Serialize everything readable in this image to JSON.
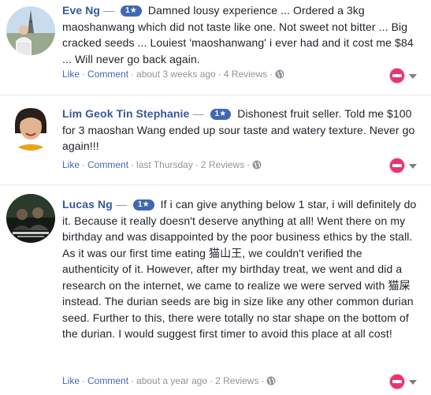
{
  "reviews": [
    {
      "author": "Eve Ng",
      "dash": "—",
      "rating": "1★",
      "text": "Damned lousy experience ... Ordered a 3kg maoshanwang which did not taste like one. Not sweet not bitter ... Big cracked seeds ... Louiest 'maoshanwang' i ever had and it cost me $84 ... Will never go back again.",
      "like": "Like",
      "comment": "Comment",
      "time": "about 3 weeks ago",
      "count": "4 Reviews",
      "dot": "·"
    },
    {
      "author": "Lim Geok Tin Stephanie",
      "dash": "—",
      "rating": "1★",
      "text": "Dishonest fruit seller. Told me $100 for 3 maoshan Wang ended up sour taste and watery texture. Never go again!!!",
      "like": "Like",
      "comment": "Comment",
      "time": "last Thursday",
      "count": "2 Reviews",
      "dot": "·"
    },
    {
      "author": "Lucas Ng",
      "dash": "—",
      "rating": "1★",
      "text": "If i can give anything below 1 star, i will definitely do it. Because it really doesn't deserve anything at all! Went there on my birthday and was disappointed by the poor business ethics by the stall. As it was our first time eating 猫山王, we couldn't verified the authenticity of it. However, after my birthday treat, we went and did a research on the internet, we came to realize we were served with 猫屎 instead. The durian seeds are big in size like any other common durian seed. Further to this, there were totally no star shape on the bottom of the durian. I would suggest first timer to avoid this place at all cost!",
      "like": "Like",
      "comment": "Comment",
      "time": "about a year ago",
      "count": "2 Reviews",
      "dot": "·"
    }
  ],
  "colors": {
    "link": "#4267b2",
    "author": "#365899",
    "meta": "#90949c",
    "reaction": "#e9336e"
  },
  "icons": [
    "globe-icon",
    "reaction-icon",
    "chevron-down-icon"
  ]
}
